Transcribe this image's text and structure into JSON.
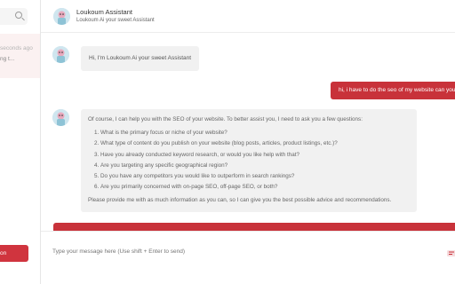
{
  "sidebar": {
    "search_icon": "search-icon",
    "conversation": {
      "time": "seconds ago",
      "preview": "ng t..."
    },
    "new_button_label": "on"
  },
  "header": {
    "name": "Loukoum Assistant",
    "subtitle": "Loukoum Ai your sweet Assistant"
  },
  "messages": {
    "bot_greeting": "Hi, I'm Loukoum Ai your sweet Assistant",
    "user_message": "hi, i have to do the seo of my website can you",
    "bot_reply": {
      "intro": "Of course, I can help you with the SEO of your website. To better assist you, I need to ask you a few questions:",
      "questions": [
        "What is the primary focus or niche of your website?",
        "What type of content do you publish on your website (blog posts, articles, product listings, etc.)?",
        "Have you already conducted keyword research, or would you like help with that?",
        "Are you targeting any specific geographical region?",
        "Do you have any competitors you would like to outperform in search rankings?",
        "Are you primarily concerned with on-page SEO, off-page SEO, or both?"
      ],
      "closing": "Please provide me with as much information as you can, so I can give you the best possible advice and recommendations."
    }
  },
  "composer": {
    "placeholder": "Type your message here (Use shift + Enter to send)"
  },
  "colors": {
    "accent": "#c8323a",
    "bubble_bg": "#f1f1f1"
  }
}
